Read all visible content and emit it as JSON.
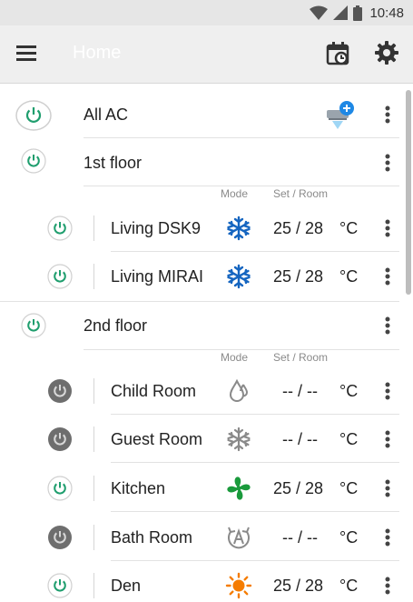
{
  "status_bar": {
    "time": "10:48"
  },
  "app_bar": {
    "title": "Home",
    "menu_icon": "hamburger-menu-icon",
    "schedule_icon": "calendar-clock-icon",
    "settings_icon": "gear-icon"
  },
  "all_ac": {
    "label": "All AC",
    "add_icon": "add-ac-unit-icon"
  },
  "groups": [
    {
      "name": "1st floor",
      "column_headers": {
        "mode": "Mode",
        "set_room": "Set / Room"
      },
      "units": [
        {
          "name": "Living DSK9",
          "power": "on",
          "mode": "cool",
          "set_room": "25 / 28",
          "unit": "°C"
        },
        {
          "name": "Living MIRAI",
          "power": "on",
          "mode": "cool",
          "set_room": "25 / 28",
          "unit": "°C"
        }
      ]
    },
    {
      "name": "2nd floor",
      "column_headers": {
        "mode": "Mode",
        "set_room": "Set / Room"
      },
      "units": [
        {
          "name": "Child Room",
          "power": "off",
          "mode": "dry",
          "set_room": "-- / --",
          "unit": "°C"
        },
        {
          "name": "Guest Room",
          "power": "off",
          "mode": "cool",
          "set_room": "-- / --",
          "unit": "°C"
        },
        {
          "name": "Kitchen",
          "power": "on",
          "mode": "fan",
          "set_room": "25 / 28",
          "unit": "°C"
        },
        {
          "name": "Bath Room",
          "power": "off",
          "mode": "auto",
          "set_room": "-- / --",
          "unit": "°C"
        },
        {
          "name": "Den",
          "power": "on",
          "mode": "heat",
          "set_room": "25 / 28",
          "unit": "°C"
        }
      ]
    }
  ],
  "colors": {
    "power_on": "#1f9e6e",
    "power_off": "#6e6e6e",
    "cool": "#1565c0",
    "fan": "#1a9a3c",
    "heat": "#f57c00",
    "inactive_mode": "#8a8a8a"
  }
}
